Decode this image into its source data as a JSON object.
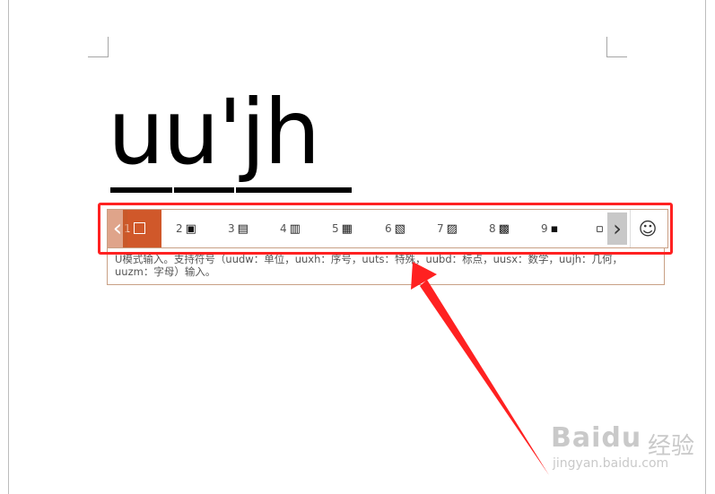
{
  "document": {
    "typed_text": "uu'jh"
  },
  "ime": {
    "nav_prev": "‹",
    "nav_next": "›",
    "emoji": "☺",
    "selected_index": "1",
    "candidates": [
      {
        "num": "2",
        "sym": "▣"
      },
      {
        "num": "3",
        "sym": "▤"
      },
      {
        "num": "4",
        "sym": "▥"
      },
      {
        "num": "5",
        "sym": "▦"
      },
      {
        "num": "6",
        "sym": "▧"
      },
      {
        "num": "7",
        "sym": "▨"
      },
      {
        "num": "8",
        "sym": "▩"
      },
      {
        "num": "9",
        "sym": "▪"
      },
      {
        "num": "",
        "sym": "▫"
      }
    ],
    "hint": "U模式输入。支持符号（uudw：单位，uuxh：序号，uuts：特殊，uubd：标点，uusx：数学，uujh：几何，uuzm：字母）输入。"
  },
  "watermark": {
    "logo": "Baidu",
    "cn": "经验",
    "url": "jingyan.baidu.com"
  },
  "colors": {
    "accent": "#d0582a",
    "highlight_red": "#ff2121"
  }
}
